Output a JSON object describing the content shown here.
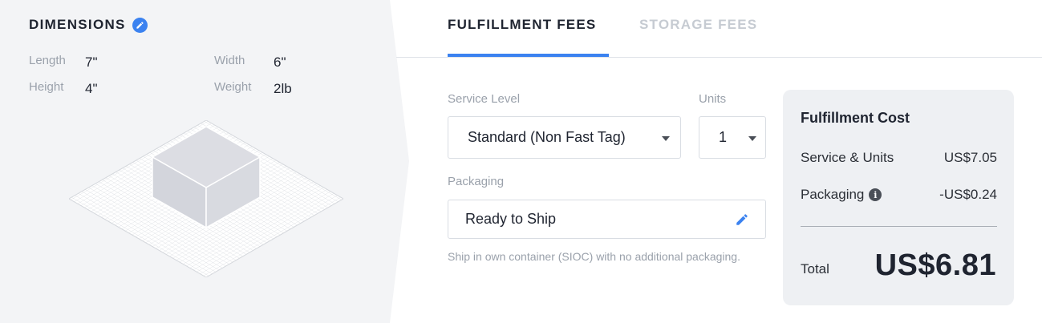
{
  "dimensions": {
    "title": "DIMENSIONS",
    "length_label": "Length",
    "length_value": "7\"",
    "width_label": "Width",
    "width_value": "6\"",
    "height_label": "Height",
    "height_value": "4\"",
    "weight_label": "Weight",
    "weight_value": "2lb"
  },
  "tabs": [
    {
      "label": "FULFILLMENT FEES",
      "active": true
    },
    {
      "label": "STORAGE FEES",
      "active": false
    }
  ],
  "form": {
    "service_level_label": "Service Level",
    "service_level_value": "Standard (Non Fast Tag)",
    "units_label": "Units",
    "units_value": "1",
    "packaging_label": "Packaging",
    "packaging_value": "Ready to Ship",
    "packaging_helper": "Ship in own container (SIOC) with no additional packaging."
  },
  "cost": {
    "title": "Fulfillment Cost",
    "service_units_label": "Service & Units",
    "service_units_value": "US$7.05",
    "packaging_label": "Packaging",
    "packaging_value": "-US$0.24",
    "total_label": "Total",
    "total_value": "US$6.81"
  },
  "icons": {
    "edit_dimensions": "pencil-icon",
    "select_caret": "caret-down-icon",
    "edit_packaging": "pencil-icon",
    "packaging_info": "info-icon"
  },
  "colors": {
    "accent": "#3b82f0",
    "panel_bg": "#f3f4f6",
    "card_bg": "#eef0f3",
    "inactive_tab": "#c6cbd2"
  }
}
